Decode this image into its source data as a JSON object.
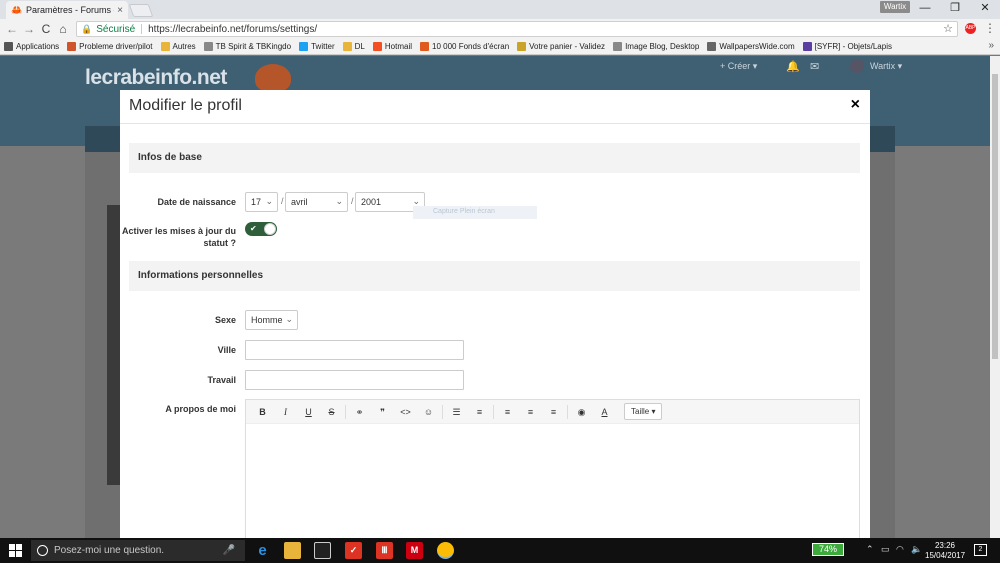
{
  "browser": {
    "tab_title": "Paramètres - Forums du",
    "tab_close": "×",
    "user_chip": "Wartix",
    "nav": {
      "back": "←",
      "forward": "→",
      "reload": "C",
      "home": "⌂"
    },
    "secure_label": "Sécurisé",
    "url": "https://lecrabeinfo.net/forums/settings/",
    "ext_label": "ABP",
    "window_controls": {
      "minimize": "—",
      "restore": "❐",
      "close": "✕"
    }
  },
  "bookmarks": [
    {
      "label": "Applications",
      "color": "#555555"
    },
    {
      "label": "Probleme driver/pilot",
      "color": "#d0542b"
    },
    {
      "label": "Autres",
      "color": "#e8b43a"
    },
    {
      "label": "TB Spirit & TBKingdo",
      "color": "#888888"
    },
    {
      "label": "Twitter",
      "color": "#1da1f2"
    },
    {
      "label": "DL",
      "color": "#e8b43a"
    },
    {
      "label": "Hotmail",
      "color": "#f25022"
    },
    {
      "label": "10 000 Fonds d'écran",
      "color": "#e05a1e"
    },
    {
      "label": "Votre panier - Validez",
      "color": "#caa32a"
    },
    {
      "label": "Image Blog, Desktop",
      "color": "#888888"
    },
    {
      "label": "WallpapersWide.com",
      "color": "#666666"
    },
    {
      "label": "[SYFR] - Objets/Lapis",
      "color": "#5b3fa0"
    }
  ],
  "site": {
    "logo": "lecrabeinfo.net",
    "create": "+ Créer ▾",
    "user": "Wartix ▾"
  },
  "modal": {
    "title": "Modifier le profil",
    "close": "×",
    "section_basic": "Infos de base",
    "birth_label": "Date de naissance",
    "birth_day": "17",
    "birth_month": "avril",
    "birth_year": "2001",
    "date_sep": "/",
    "status_label": "Activer les mises à jour du statut ?",
    "ghost_text": "Capture Plein écran",
    "section_personal": "Informations personnelles",
    "sex_label": "Sexe",
    "sex_value": "Homme",
    "city_label": "Ville",
    "city_value": "",
    "job_label": "Travail",
    "job_value": "",
    "about_label": "A propos de moi",
    "toolbar": {
      "bold": "B",
      "italic": "I",
      "underline": "U",
      "strike": "S",
      "link": "⚭",
      "quote": "❞",
      "code": "<>",
      "emoji": "☺",
      "ul": "☰",
      "ol": "≡",
      "align_left": "≡",
      "align_center": "≡",
      "align_right": "≡",
      "preview": "◉",
      "color": "A",
      "size": "Taille ▾"
    }
  },
  "taskbar": {
    "search_placeholder": "Posez-moi une question.",
    "battery": "74%",
    "time": "23:26",
    "date": "15/04/2017"
  }
}
